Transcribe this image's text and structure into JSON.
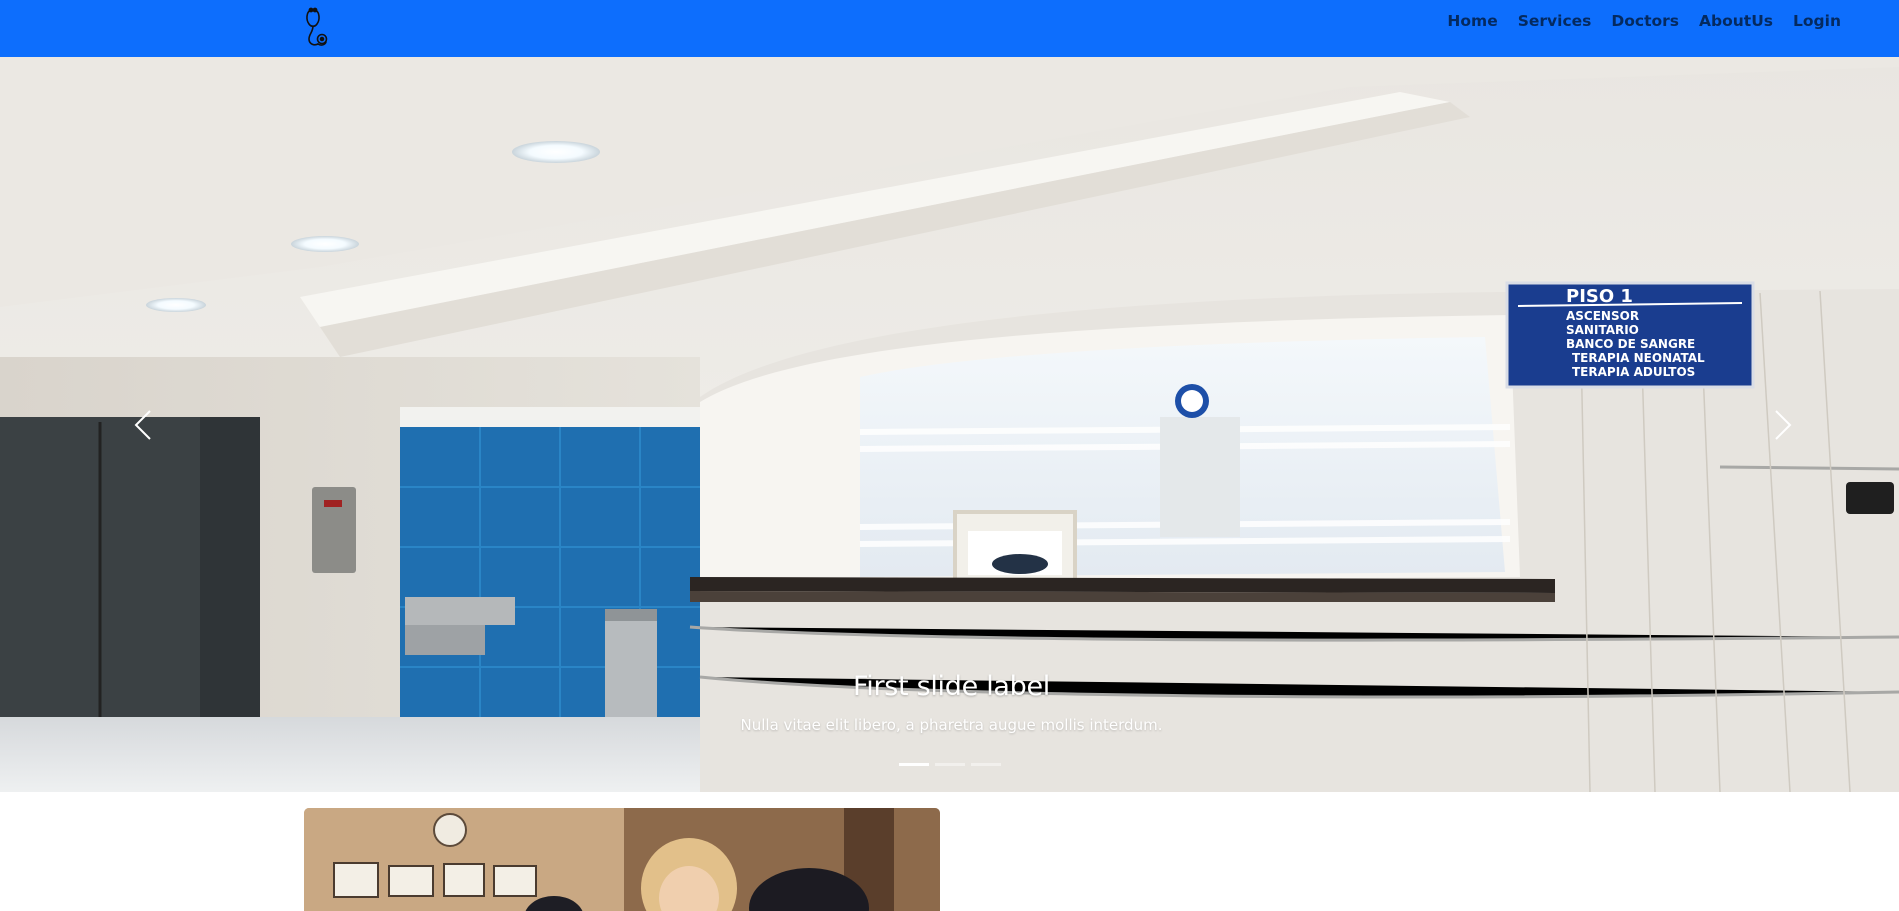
{
  "navbar": {
    "logo_icon": "stethoscope-icon",
    "links": [
      "Home",
      "Services",
      "Doctors",
      "AboutUs",
      "Login"
    ],
    "background_color": "#0d6efd",
    "link_color": "rgba(0,0,0,0.62)"
  },
  "carousel": {
    "slides": [
      {
        "title": "First slide label",
        "text": "Nulla vitae elit libero, a pharetra augue mollis interdum.",
        "image": "hospital-reception-photo"
      }
    ],
    "active_index": 0,
    "slide_count": 3,
    "prev_icon": "chevron-left-icon",
    "next_icon": "chevron-right-icon",
    "sign": {
      "heading": "PISO 1",
      "items": [
        "ASCENSOR",
        "SANITARIO",
        "BANCO DE SANGRE",
        "TERAPIA NEONATAL",
        "TERAPIA ADULTOS"
      ]
    }
  },
  "card": {
    "image": "doctor-office-photo"
  }
}
